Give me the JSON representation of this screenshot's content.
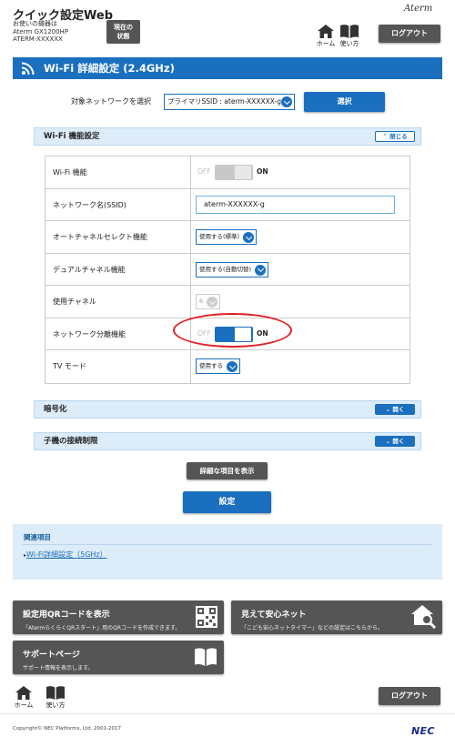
{
  "header": {
    "app_title": "クイック設定Web",
    "device_caption": "お使いの機器は",
    "device_model": "Aterm GX1200HP",
    "device_name": "ATERM-XXXXXX",
    "status_button_line1": "現在の",
    "status_button_line2": "状態",
    "brand_logo": "Aterm",
    "home_label": "ホーム",
    "manual_label": "使い方",
    "logout_label": "ログアウト"
  },
  "page_title": "Wi-Fi 詳細設定 (2.4GHz)",
  "network_select": {
    "label": "対象ネットワークを選択",
    "value": "プライマリSSID : aterm-XXXXXX-g",
    "button": "選択"
  },
  "sections": {
    "wifi_function": {
      "title": "Wi-Fi 機能設定",
      "toggle_label": "閉じる"
    },
    "encryption": {
      "title": "暗号化",
      "toggle_label": "開く"
    },
    "access_limit": {
      "title": "子機の接続制限",
      "toggle_label": "開く"
    }
  },
  "settings": {
    "wifi_function": {
      "label": "Wi-Fi 機能",
      "off_text": "OFF",
      "on_text": "ON",
      "state": "on",
      "enabled": false
    },
    "ssid": {
      "label": "ネットワーク名(SSID)",
      "value": "aterm-XXXXXX-g"
    },
    "auto_channel": {
      "label": "オートチャネルセレクト機能",
      "value": "使用する(標準)"
    },
    "dual_channel": {
      "label": "デュアルチャネル機能",
      "value": "使用する(自動切替)"
    },
    "channel": {
      "label": "使用チャネル",
      "value": "6",
      "enabled": false
    },
    "network_isolation": {
      "label": "ネットワーク分離機能",
      "off_text": "OFF",
      "on_text": "ON",
      "state": "on",
      "enabled": true
    },
    "tv_mode": {
      "label": "TV モード",
      "value": "使用する"
    }
  },
  "buttons": {
    "show_details": "詳細な項目を表示",
    "apply": "設定"
  },
  "related": {
    "title": "関連項目",
    "link": "Wi-Fi詳細設定（5GHz）"
  },
  "cards": {
    "qr": {
      "title": "設定用QRコードを表示",
      "desc": "「AtermらくらくQRスタート」用のQRコードを作成できます。"
    },
    "safety": {
      "title": "見えて安心ネット",
      "desc": "「こども安心ネットタイマー」などの設定はこちらから。"
    },
    "support": {
      "title": "サポートページ",
      "desc": "サポート情報を表示します。"
    }
  },
  "footer": {
    "home_label": "ホーム",
    "manual_label": "使い方",
    "logout_label": "ログアウト",
    "copyright": "Copyright© NEC Platforms, Ltd. 2001-2017",
    "brand": "NEC"
  },
  "colors": {
    "accent": "#1a6fbf",
    "dark_button": "#555555",
    "section_bg": "#dcecf8",
    "highlight": "#e02020"
  }
}
